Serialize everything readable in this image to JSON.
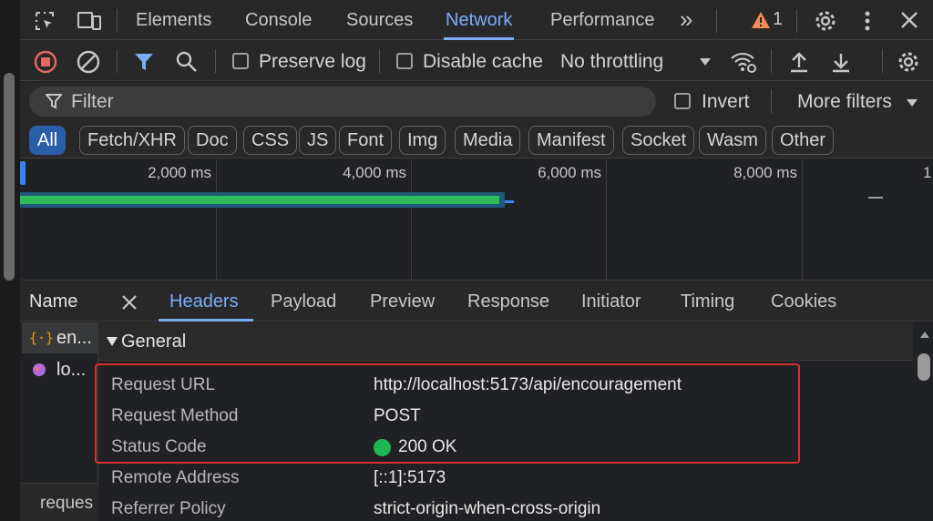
{
  "tabs": {
    "elements": "Elements",
    "console": "Console",
    "sources": "Sources",
    "network": "Network",
    "performance": "Performance",
    "more": "»",
    "warning_count": "1"
  },
  "toolbar": {
    "preserve_log": "Preserve log",
    "disable_cache": "Disable cache",
    "throttling": "No throttling"
  },
  "filter": {
    "placeholder": "Filter",
    "invert": "Invert",
    "more_filters": "More filters"
  },
  "types": [
    "All",
    "Fetch/XHR",
    "Doc",
    "CSS",
    "JS",
    "Font",
    "Img",
    "Media",
    "Manifest",
    "Socket",
    "Wasm",
    "Other"
  ],
  "timeline": {
    "ticks": [
      "2,000 ms",
      "4,000 ms",
      "6,000 ms",
      "8,000 ms",
      "1"
    ]
  },
  "requests": {
    "header": "Name",
    "rows": [
      "en...",
      "lo..."
    ],
    "footer": "reques"
  },
  "detail": {
    "tabs": [
      "Headers",
      "Payload",
      "Preview",
      "Response",
      "Initiator",
      "Timing",
      "Cookies"
    ],
    "section": "General",
    "fields": [
      {
        "key": "Request URL",
        "value": "http://localhost:5173/api/encouragement"
      },
      {
        "key": "Request Method",
        "value": "POST"
      },
      {
        "key": "Status Code",
        "value": "200 OK"
      },
      {
        "key": "Remote Address",
        "value": "[::1]:5173"
      },
      {
        "key": "Referrer Policy",
        "value": "strict-origin-when-cross-origin"
      }
    ]
  },
  "colors": {
    "accent": "#7cacf8",
    "record": "#e46962",
    "status_ok": "#1eb751",
    "highlight": "#d93030",
    "bar_green": "#2ebd5a",
    "bar_teal": "#1e5a78"
  }
}
